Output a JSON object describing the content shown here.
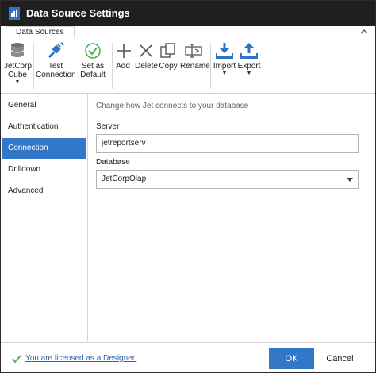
{
  "window": {
    "title": "Data Source Settings"
  },
  "tabs": [
    {
      "label": "Data Sources"
    }
  ],
  "ribbon": {
    "jetcorp_cube": "JetCorp\nCube",
    "test_connection": "Test\nConnection",
    "set_as_default": "Set as\nDefault",
    "add": "Add",
    "delete": "Delete",
    "copy": "Copy",
    "rename": "Rename",
    "import": "Import",
    "export": "Export"
  },
  "sidebar": {
    "items": [
      {
        "label": "General"
      },
      {
        "label": "Authentication"
      },
      {
        "label": "Connection"
      },
      {
        "label": "Drilldown"
      },
      {
        "label": "Advanced"
      }
    ],
    "active": "Connection"
  },
  "main": {
    "heading": "Change how Jet connects to your database",
    "server_label": "Server",
    "server_value": "jetreportserv",
    "database_label": "Database",
    "database_value": "JetCorpOlap"
  },
  "footer": {
    "license_text": "You are licensed as a Designer.",
    "ok_label": "OK",
    "cancel_label": "Cancel"
  },
  "colors": {
    "accent": "#3277c8",
    "titlebar": "#1f1f1f",
    "icon_blue": "#2f73c4",
    "check_green": "#4caf50"
  }
}
